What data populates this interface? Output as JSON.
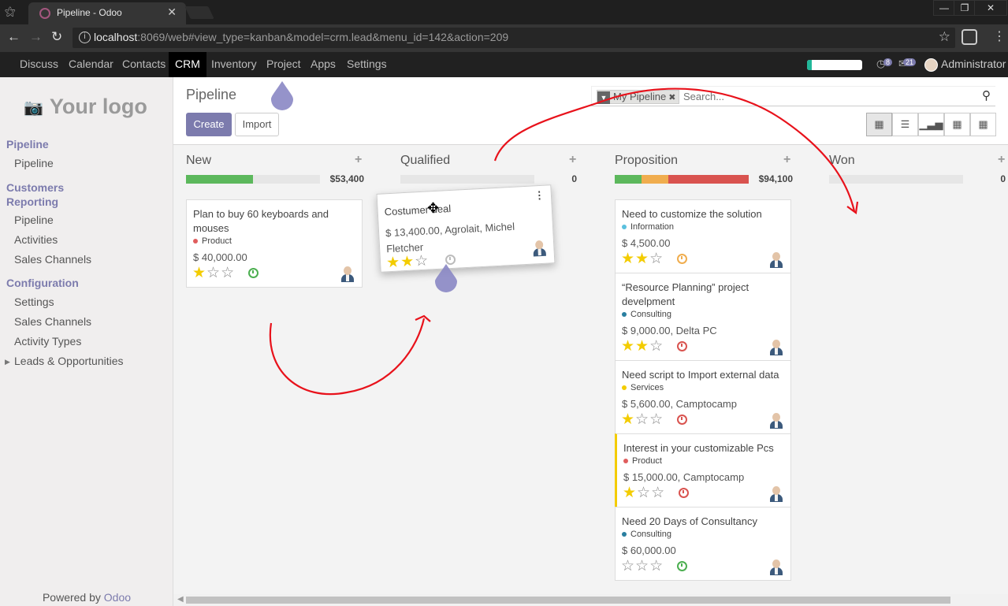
{
  "browser": {
    "tab_title": "Pipeline - Odoo",
    "url_host": "localhost",
    "url_rest": ":8069/web#view_type=kanban&model=crm.lead&menu_id=142&action=209"
  },
  "topmenu": {
    "items": [
      "Discuss",
      "Calendar",
      "Contacts",
      "CRM",
      "Inventory",
      "Project",
      "Apps",
      "Settings"
    ],
    "active": "CRM",
    "chat_count": "8",
    "message_count": "21",
    "user": "Administrator"
  },
  "sidebar": {
    "logo": "Your logo",
    "sections": [
      {
        "title": "Pipeline",
        "items": [
          "Pipeline"
        ]
      },
      {
        "title": "Customers Reporting",
        "items": [
          "Pipeline",
          "Activities",
          "Sales Channels"
        ]
      },
      {
        "title": "Configuration",
        "items": [
          "Settings",
          "Sales Channels",
          "Activity Types",
          "Leads & Opportunities"
        ]
      }
    ],
    "powered_prefix": "Powered by",
    "powered_brand": "Odoo"
  },
  "control": {
    "breadcrumb": "Pipeline",
    "create_label": "Create",
    "import_label": "Import",
    "facet_label": "My Pipeline",
    "search_placeholder": "Search..."
  },
  "columns": [
    {
      "title": "New",
      "total": "$53,400",
      "progress": [
        {
          "color": "#5cb85c",
          "pct": 50
        }
      ],
      "cards": [
        {
          "name": "Plan to buy 60 keyboards and mouses",
          "tag": "Product",
          "tag_color": "#e05d5d",
          "amount": "$ 40,000.00",
          "stars": 1,
          "clock": "#4caf50"
        }
      ]
    },
    {
      "title": "Qualified",
      "total": "0",
      "progress": [],
      "cards": [
        {
          "name": "Costumer deal",
          "amount": "$ 13,400.00, Agrolait, Michel Fletcher",
          "stars": 2,
          "clock": "#bbbbbb"
        }
      ]
    },
    {
      "title": "Proposition",
      "total": "$94,100",
      "progress": [
        {
          "color": "#5cb85c",
          "pct": 20
        },
        {
          "color": "#f0ad4e",
          "pct": 20
        },
        {
          "color": "#d9534f",
          "pct": 60
        }
      ],
      "cards": [
        {
          "name": "Need to customize the solution",
          "tag": "Information",
          "tag_color": "#5bc0de",
          "amount": "$ 4,500.00",
          "stars": 2,
          "clock": "#f0ad4e"
        },
        {
          "name": "“Resource Planning” project develpment",
          "tag": "Consulting",
          "tag_color": "#2a7fa0",
          "amount": "$ 9,000.00, Delta PC",
          "stars": 2,
          "clock": "#d9534f"
        },
        {
          "name": "Need script to Import external data",
          "tag": "Services",
          "tag_color": "#f3cc00",
          "amount": "$ 5,600.00, Camptocamp",
          "stars": 1,
          "clock": "#d9534f"
        },
        {
          "name": "Interest in your customizable Pcs",
          "tag": "Product",
          "tag_color": "#e05d5d",
          "amount": "$ 15,000.00, Camptocamp",
          "stars": 1,
          "clock": "#d9534f"
        },
        {
          "name": "Need 20 Days of Consultancy",
          "tag": "Consulting",
          "tag_color": "#2a7fa0",
          "amount": "$ 60,000.00",
          "stars": 0,
          "clock": "#4caf50"
        }
      ]
    },
    {
      "title": "Won",
      "total": "0",
      "progress": [],
      "cards": []
    }
  ]
}
